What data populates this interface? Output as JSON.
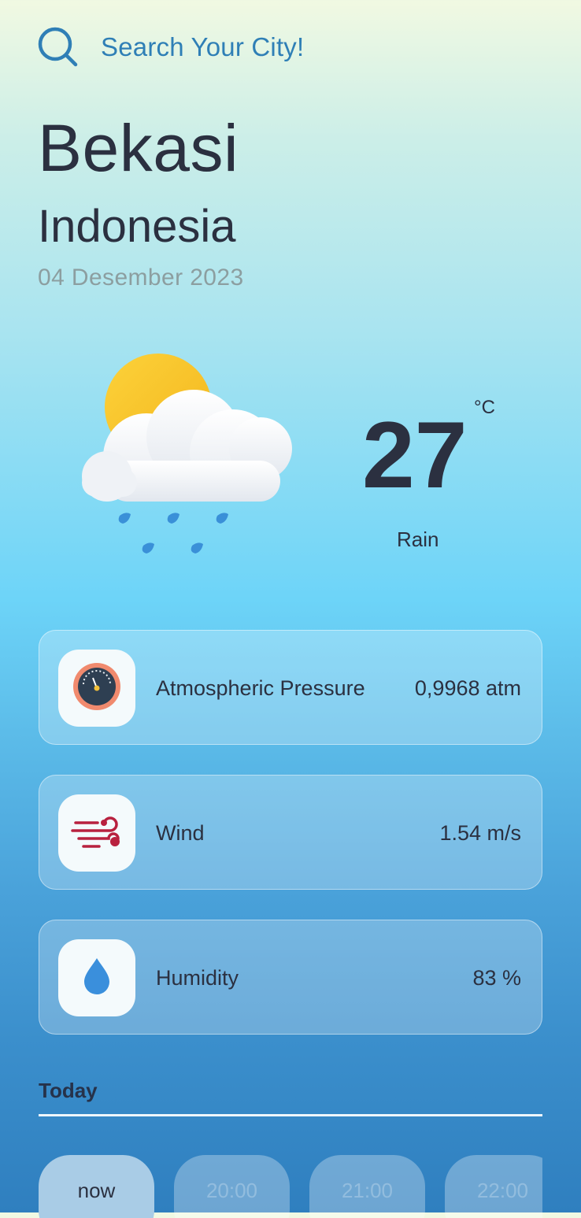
{
  "search": {
    "placeholder": "Search Your City!"
  },
  "location": {
    "city": "Bekasi",
    "country": "Indonesia",
    "date": "04 Desember 2023"
  },
  "current": {
    "temperature": "27",
    "unit": "°C",
    "condition": "Rain",
    "icon": "sun-cloud-rain-icon"
  },
  "stats": [
    {
      "label": "Atmospheric Pressure",
      "value": "0,9968 atm",
      "icon": "pressure-gauge-icon"
    },
    {
      "label": "Wind",
      "value": "1.54 m/s",
      "icon": "wind-icon"
    },
    {
      "label": "Humidity",
      "value": "83 %",
      "icon": "water-drop-icon"
    }
  ],
  "today": {
    "title": "Today",
    "hours": [
      {
        "label": "now",
        "active": true
      },
      {
        "label": "20:00",
        "active": false
      },
      {
        "label": "21:00",
        "active": false
      },
      {
        "label": "22:00",
        "active": false
      }
    ]
  },
  "colors": {
    "accent": "#2f7fb6",
    "text": "#2b3040",
    "date": "#8c9ea0",
    "wind_icon": "#b8213f",
    "drop_icon": "#3a8fdc",
    "gauge_ring": "#f08a6e"
  }
}
